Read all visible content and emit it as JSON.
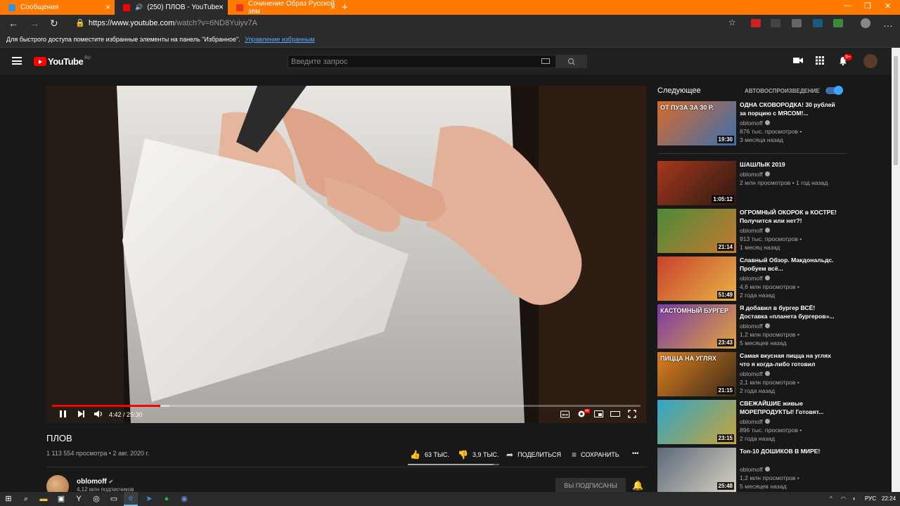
{
  "browser": {
    "tabs": [
      {
        "title": "Сообщения"
      },
      {
        "title": "(250) ПЛОВ - YouTube"
      },
      {
        "title": "Сочинение Образ Русской зем"
      }
    ],
    "url_host": "https://www.youtube.com",
    "url_path": "/watch?v=6ND8Yuiyv7A",
    "favorites_hint": "Для быстрого доступа поместите избранные элементы на панель \"Избранное\".",
    "favorites_link": "Управление избранным"
  },
  "header": {
    "logo": "YouTube",
    "region": "RU",
    "search_placeholder": "Введите запрос",
    "notif_count": "9+"
  },
  "player": {
    "time": "4:42 / 25:30",
    "progress_fraction": 0.184,
    "buffer_fraction": 0.2,
    "hd_badge": "4K"
  },
  "video": {
    "title": "ПЛОВ",
    "stats": "1 113 554 просмотра • 2 авг. 2020 г.",
    "likes": "63 ТЫС.",
    "dislikes": "3,9 ТЫС.",
    "like_fraction": 0.94,
    "share": "ПОДЕЛИТЬСЯ",
    "save": "СОХРАНИТЬ",
    "more": "•••"
  },
  "channel": {
    "name": "oblomoff",
    "subs": "4,12 млн подписчиков",
    "subscribed_label": "ВЫ ПОДПИСАНЫ"
  },
  "sidebar": {
    "next_label": "Следующее",
    "autoplay_label": "АВТОВОСПРОИЗВЕДЕНИЕ",
    "autoplay_on": true,
    "videos": [
      {
        "title": "ОДНА СКОВОРОДКА! 30 рублей за порцию с МЯСОМ!...",
        "channel": "oblomoff",
        "views": "876 тыс. просмотров •",
        "age": "3 месяца назад",
        "duration": "19:30",
        "thumb_text": "ОТ ПУЗА ЗА 30 Р.",
        "colors": [
          "#d86b2a",
          "#3a6fb0"
        ]
      },
      {
        "title": "ШАШЛЫК 2019",
        "channel": "oblomoff",
        "views": "2 млн просмотров • 1 год назад",
        "age": "",
        "duration": "1:05:12",
        "thumb_text": "",
        "colors": [
          "#a8381c",
          "#2b1a12"
        ]
      },
      {
        "title": "ОГРОМНЫЙ ОКОРОК в КОСТРЕ! Получится или нет?!",
        "channel": "oblomoff",
        "views": "913 тыс. просмотров •",
        "age": "1 месяц назад",
        "duration": "21:14",
        "thumb_text": "",
        "colors": [
          "#4c8a3a",
          "#c57a2e"
        ]
      },
      {
        "title": "Славный Обзор. Макдональдс. Пробуем всё...",
        "channel": "oblomoff",
        "views": "4,6 млн просмотров •",
        "age": "2 года назад",
        "duration": "51:49",
        "thumb_text": "",
        "colors": [
          "#c9412b",
          "#e7b347"
        ]
      },
      {
        "title": "Я добавил в бургер ВСЁ! Доставка «планета бургеров»...",
        "channel": "oblomoff",
        "views": "1,2 млн просмотров •",
        "age": "5 месяцев назад",
        "duration": "23:43",
        "thumb_text": "КАСТОМНЫЙ БУРГЕР",
        "colors": [
          "#7a3aa8",
          "#e2a43a"
        ]
      },
      {
        "title": "Самая вкусная пицца на углях что я когда-либо готовил",
        "channel": "oblomoff",
        "views": "2,1 млн просмотров •",
        "age": "2 года назад",
        "duration": "21:15",
        "thumb_text": "ПИЦЦА НА УГЛЯХ",
        "colors": [
          "#e0801e",
          "#3a2a1a"
        ]
      },
      {
        "title": "СВЕЖАЙШИЕ живые МОРЕПРОДУКТЫ! Готовят...",
        "channel": "oblomoff",
        "views": "896 тыс. просмотров •",
        "age": "2 года назад",
        "duration": "23:15",
        "thumb_text": "",
        "colors": [
          "#2ea6c8",
          "#c8a33a"
        ]
      },
      {
        "title": "Топ-10 ДОШИКОВ В МИРЕ!",
        "channel": "oblomoff",
        "views": "1,2 млн просмотров •",
        "age": "5 месяцев назад",
        "duration": "25:48",
        "thumb_text": "",
        "colors": [
          "#5a6a7a",
          "#d8d0c0"
        ]
      }
    ]
  },
  "taskbar": {
    "lang": "РУС",
    "time": "22:24"
  },
  "colors": {
    "browser_accent": "#ff7a00",
    "yt_red": "#ff0000",
    "autoplay_blue": "#3ea6ff"
  }
}
